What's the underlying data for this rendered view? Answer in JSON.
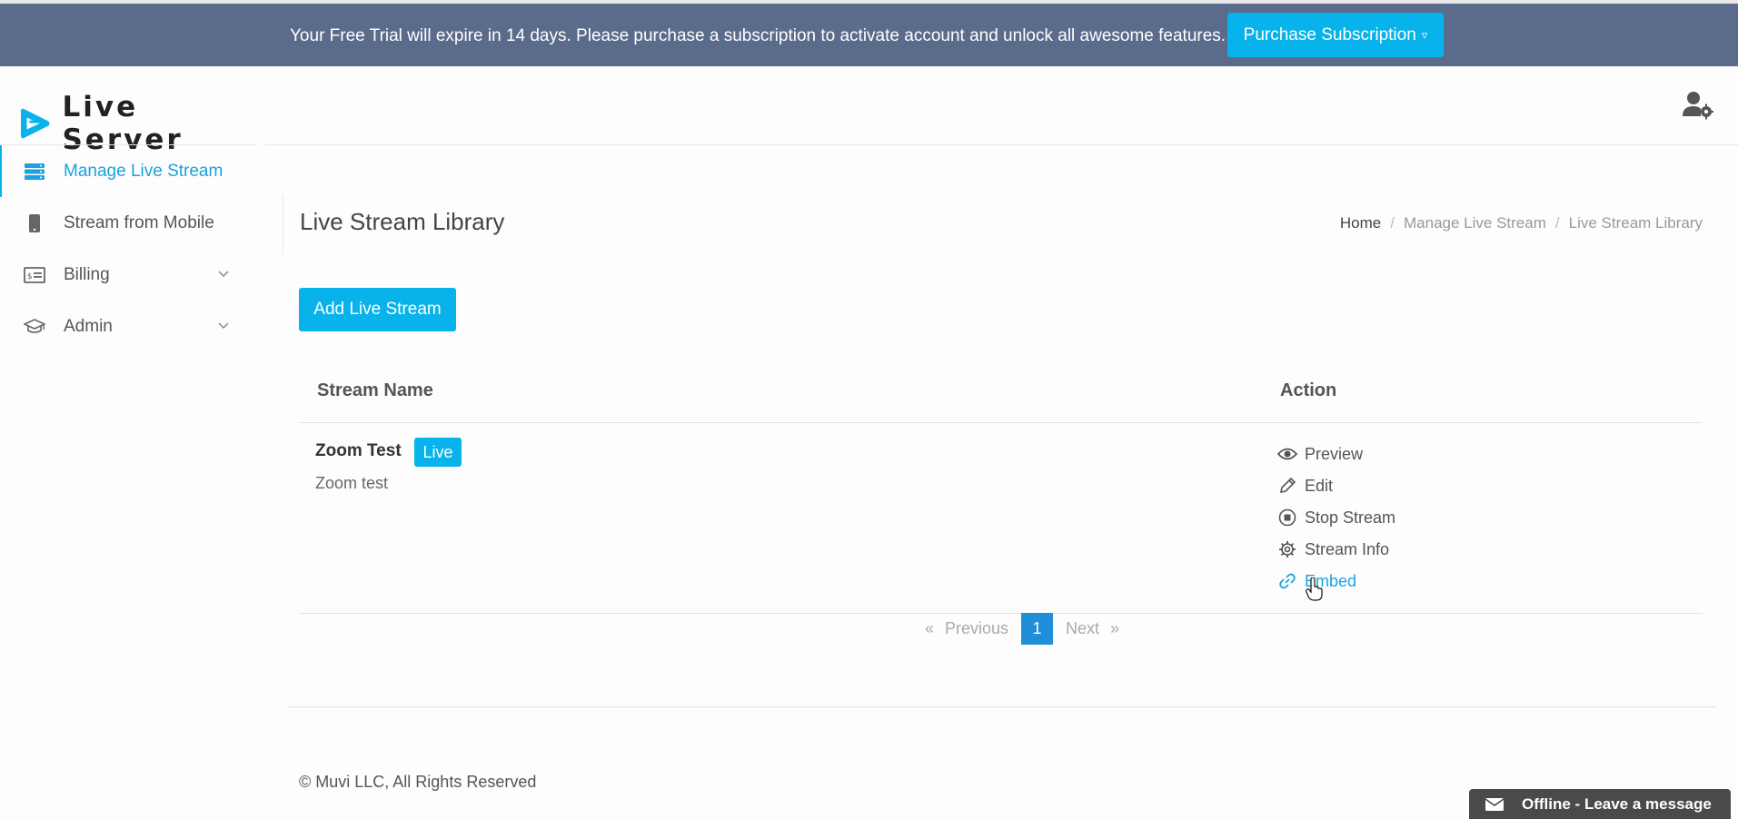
{
  "banner": {
    "text": "Your Free Trial will expire in 14 days. Please purchase a subscription to activate account and unlock all awesome features.",
    "button_label": "Purchase Subscription"
  },
  "logo": {
    "text": "Live Server"
  },
  "sidebar": {
    "items": [
      {
        "label": "Manage Live Stream",
        "icon": "server-icon",
        "active": true
      },
      {
        "label": "Stream from Mobile",
        "icon": "mobile-icon",
        "active": false
      },
      {
        "label": "Billing",
        "icon": "billing-card-icon",
        "active": false,
        "expandable": true
      },
      {
        "label": "Admin",
        "icon": "graduation-cap-icon",
        "active": false,
        "expandable": true
      }
    ]
  },
  "header": {
    "user_icon": "user-gear-icon"
  },
  "page": {
    "title": "Live Stream Library",
    "breadcrumb": [
      "Home",
      "Manage Live Stream",
      "Live Stream Library"
    ],
    "add_button_label": "Add Live Stream"
  },
  "table": {
    "headers": [
      "Stream Name",
      "Action"
    ],
    "rows": [
      {
        "name": "Zoom Test",
        "badge": "Live",
        "description": "Zoom test",
        "actions": [
          {
            "label": "Preview",
            "icon": "eye-icon"
          },
          {
            "label": "Edit",
            "icon": "pencil-icon"
          },
          {
            "label": "Stop Stream",
            "icon": "stop-circle-icon"
          },
          {
            "label": "Stream Info",
            "icon": "gear-icon"
          },
          {
            "label": "Embed",
            "icon": "link-icon",
            "hover": true
          }
        ]
      }
    ]
  },
  "pagination": {
    "prev_label": "Previous",
    "prev_glyph": "«",
    "current": "1",
    "next_label": "Next",
    "next_glyph": "»"
  },
  "footer": {
    "copyright": "© Muvi LLC, All Rights Reserved"
  },
  "chat": {
    "label": "Offline - Leave a message"
  },
  "colors": {
    "accent": "#07b3ea",
    "banner_bg": "#5b6b8c",
    "active_text": "#1aa3df",
    "page_active": "#1e8fd8",
    "chat_bg": "#4a4a4a"
  }
}
